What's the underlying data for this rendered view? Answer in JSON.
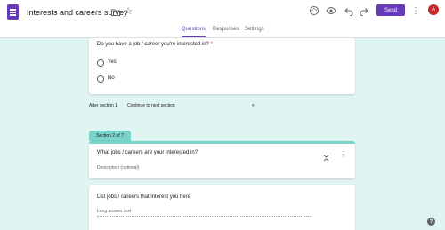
{
  "header": {
    "title": "Interests and careers survey",
    "send_label": "Send",
    "avatar_letter": "A",
    "icons": [
      "forms-logo-icon",
      "folder-icon",
      "star-icon",
      "palette-icon",
      "preview-eye-icon",
      "undo-icon",
      "redo-icon",
      "more-vert-icon"
    ]
  },
  "tabs": [
    {
      "label": "Questions",
      "active": true
    },
    {
      "label": "Responses",
      "active": false
    },
    {
      "label": "Settings",
      "active": false
    }
  ],
  "question1": {
    "title": "Do you have a job / career you're interested in?",
    "required_mark": "*",
    "options": [
      "Yes",
      "No"
    ]
  },
  "section_nav": {
    "after_label": "After section 1",
    "selected": "Continue to next section"
  },
  "section2": {
    "badge": "Section 2 of 7",
    "title": "What jobs / careers are your interested in?",
    "description_placeholder": "Description (optional)"
  },
  "question2": {
    "title": "List jobs / careers that interest you here",
    "placeholder": "Long answer text"
  },
  "colors": {
    "accent": "#673ab7",
    "background": "#e0f4f2",
    "section_tab": "#79d3c8",
    "avatar": "#c62828"
  }
}
